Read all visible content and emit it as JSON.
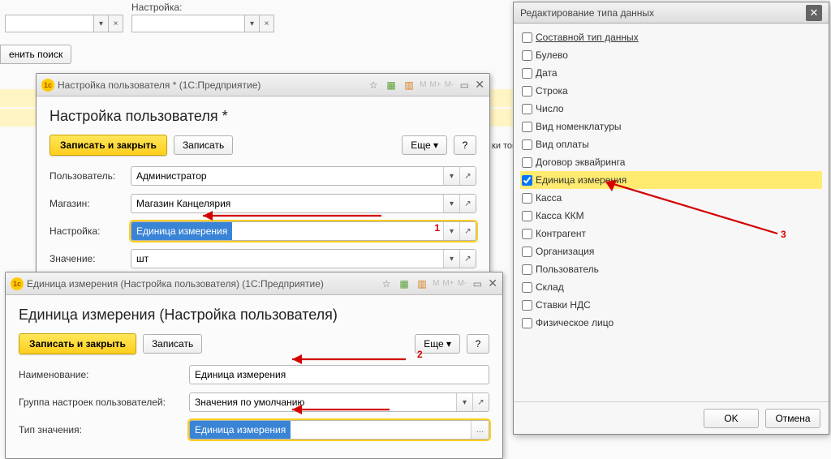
{
  "top": {
    "setting_label": "Настройка:",
    "search_btn": "енить поиск"
  },
  "bg_snippet": "ки товаров",
  "win1": {
    "title": "Настройка пользователя *  (1С:Предприятие)",
    "heading": "Настройка пользователя *",
    "save_close": "Записать и закрыть",
    "save": "Записать",
    "more": "Еще",
    "help": "?",
    "rows": {
      "user_label": "Пользователь:",
      "user_value": "Администратор",
      "shop_label": "Магазин:",
      "shop_value": "Магазин Канцелярия",
      "setting_label": "Настройка:",
      "setting_value": "Единица измерения",
      "value_label": "Значение:",
      "value_value": "шт"
    },
    "annot": "1"
  },
  "win2": {
    "title": "Единица измерения (Настройка пользователя)  (1С:Предприятие)",
    "heading": "Единица измерения (Настройка пользователя)",
    "save_close": "Записать и закрыть",
    "save": "Записать",
    "more": "Еще",
    "help": "?",
    "rows": {
      "name_label": "Наименование:",
      "name_value": "Единица измерения",
      "group_label": "Группа настроек пользователей:",
      "group_value": "Значения по умолчанию",
      "type_label": "Тип значения:",
      "type_value": "Единица измерения"
    },
    "annot": "2"
  },
  "modal": {
    "title": "Редактирование типа данных",
    "items": [
      {
        "label": "Составной тип данных",
        "checked": false,
        "first": true
      },
      {
        "label": "Булево",
        "checked": false
      },
      {
        "label": "Дата",
        "checked": false
      },
      {
        "label": "Строка",
        "checked": false
      },
      {
        "label": "Число",
        "checked": false
      },
      {
        "label": "Вид номенклатуры",
        "checked": false
      },
      {
        "label": "Вид оплаты",
        "checked": false
      },
      {
        "label": "Договор эквайринга",
        "checked": false
      },
      {
        "label": "Единица измерения",
        "checked": true,
        "selected": true
      },
      {
        "label": "Касса",
        "checked": false
      },
      {
        "label": "Касса ККМ",
        "checked": false
      },
      {
        "label": "Контрагент",
        "checked": false
      },
      {
        "label": "Организация",
        "checked": false
      },
      {
        "label": "Пользователь",
        "checked": false
      },
      {
        "label": "Склад",
        "checked": false
      },
      {
        "label": "Ставки НДС",
        "checked": false
      },
      {
        "label": "Физическое лицо",
        "checked": false
      }
    ],
    "ok": "OK",
    "cancel": "Отмена",
    "annot": "3"
  }
}
